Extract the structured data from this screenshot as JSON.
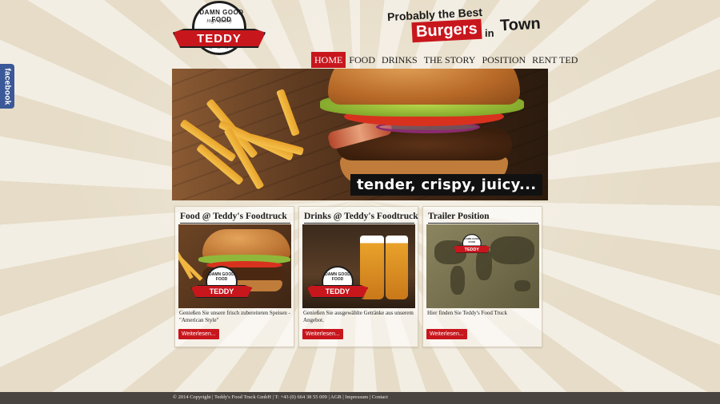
{
  "facebook_tab": {
    "label": "facebook"
  },
  "logo": {
    "arc_text": "DAMN GOOD FOOD",
    "sub_text": "High Quality",
    "name": "TEDDY",
    "stars": "★ ★ ★ ★ ★"
  },
  "tagline": {
    "line1": "Probably the Best",
    "highlight": "Burgers",
    "in": "in",
    "town": "Town"
  },
  "nav": {
    "items": [
      {
        "label": "HOME",
        "active": true
      },
      {
        "label": "FOOD",
        "active": false
      },
      {
        "label": "DRINKS",
        "active": false
      },
      {
        "label": "THE STORY",
        "active": false
      },
      {
        "label": "POSITION",
        "active": false
      },
      {
        "label": "RENT TED",
        "active": false
      }
    ]
  },
  "hero": {
    "caption": "tender, crispy, juicy..."
  },
  "cards": [
    {
      "title": "Food @ Teddy's Foodtruck",
      "text": "Genießen Sie unsere frisch zubereiteten Speisen - \"American Style\"",
      "button": "Weiterlesen...",
      "image": "burger-photo"
    },
    {
      "title": "Drinks @ Teddy's Foodtruck",
      "text": "Genießen Sie ausgewählte Getränke aus unserem Angebot.",
      "button": "Weiterlesen...",
      "image": "beer-photo"
    },
    {
      "title": "Trailer Position",
      "text": "Hier finden Sie Teddy's Food Truck",
      "button": "Weiterlesen...",
      "image": "world-map-photo"
    }
  ],
  "footer": {
    "text": "© 2014 Copyright | Teddy's Food Truck GmbH | T: +43 (0) 664 38 55 009 | AGB | Impressum | Contact"
  },
  "colors": {
    "accent": "#c8161d",
    "background": "#efe9dc",
    "footer": "#4a4440"
  }
}
